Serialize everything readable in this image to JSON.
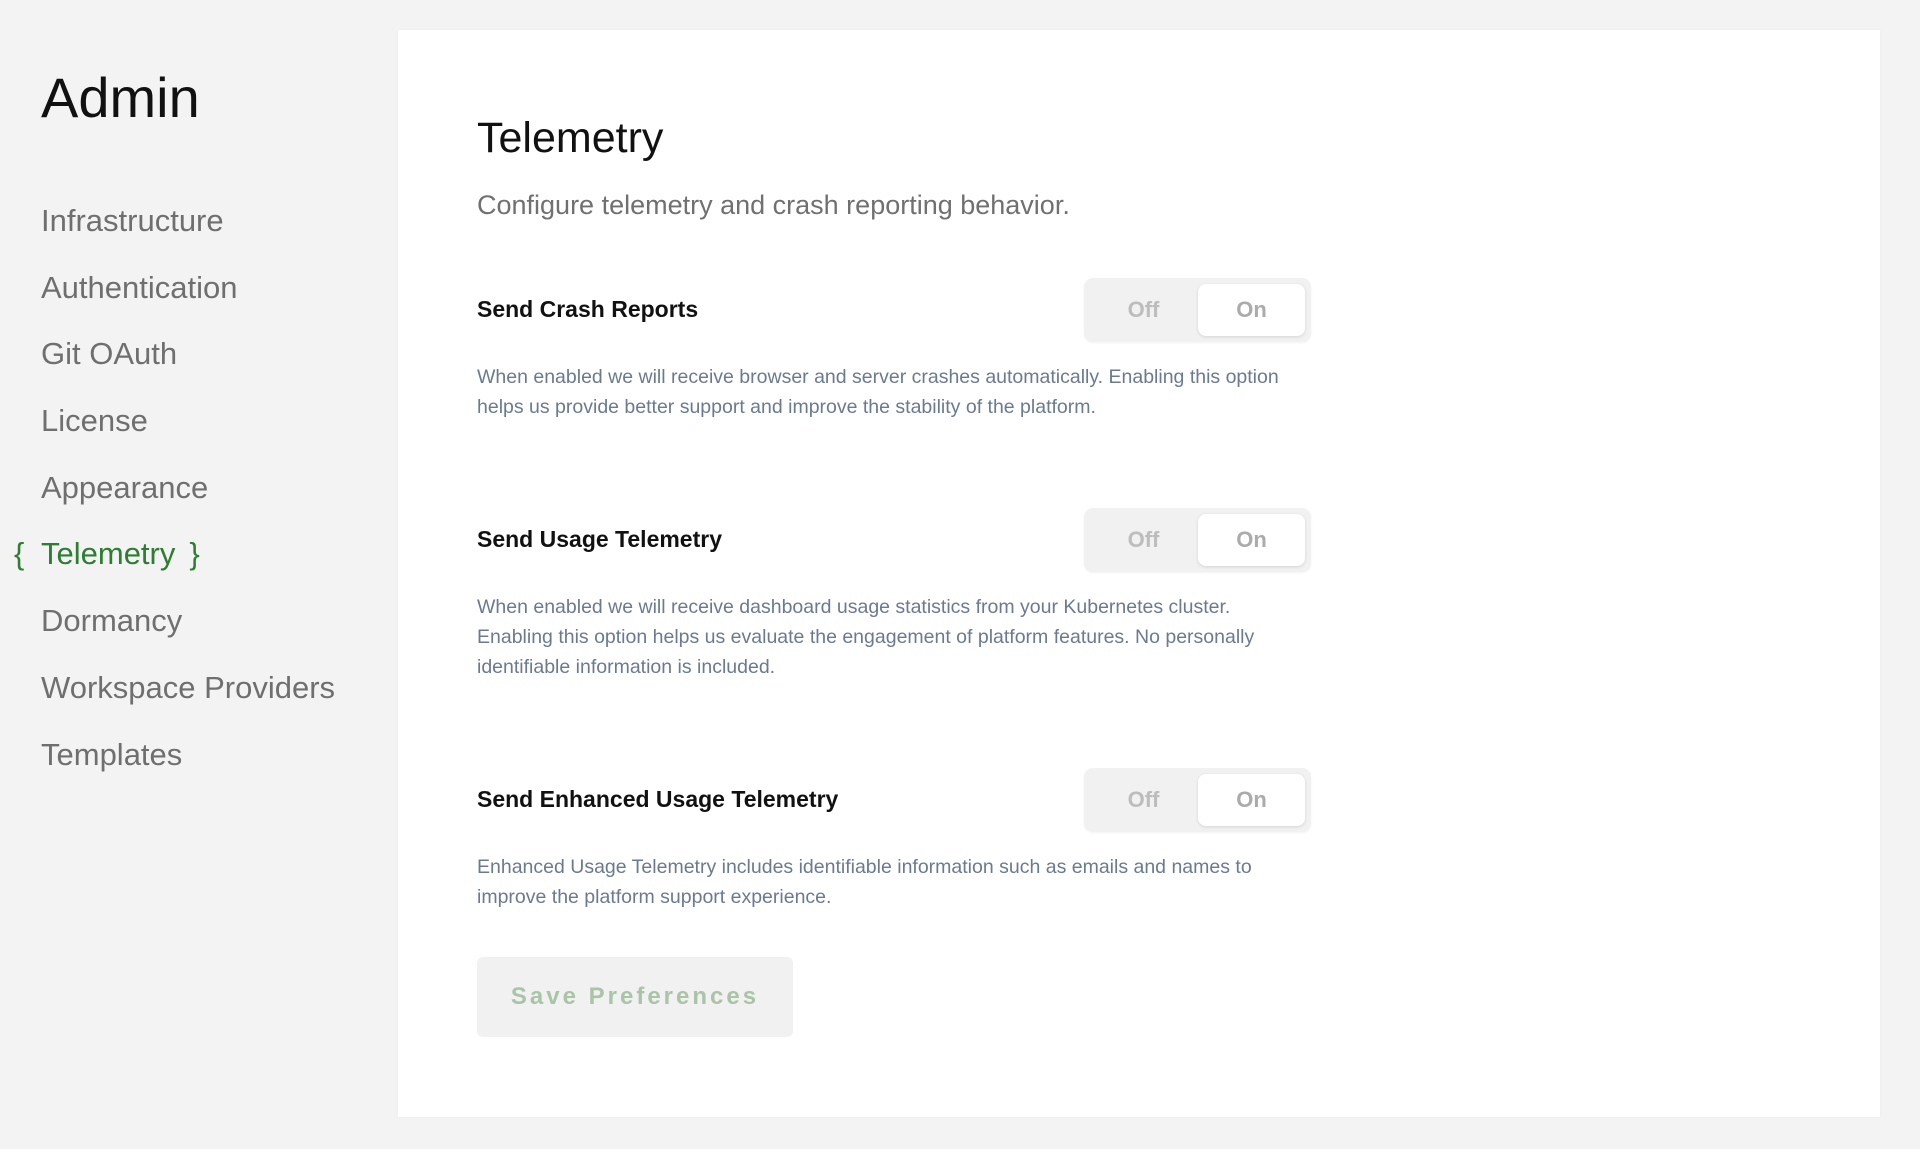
{
  "sidebar": {
    "title": "Admin",
    "items": [
      {
        "label": "Infrastructure"
      },
      {
        "label": "Authentication"
      },
      {
        "label": "Git OAuth"
      },
      {
        "label": "License"
      },
      {
        "label": "Appearance"
      },
      {
        "label": "Telemetry",
        "active": true,
        "brace_open": "{",
        "brace_close": "}"
      },
      {
        "label": "Dormancy"
      },
      {
        "label": "Workspace Providers"
      },
      {
        "label": "Templates"
      }
    ]
  },
  "main": {
    "title": "Telemetry",
    "subtitle": "Configure telemetry and crash reporting behavior.",
    "settings": [
      {
        "label": "Send Crash Reports",
        "off_label": "Off",
        "on_label": "On",
        "value": "On",
        "description": "When enabled we will receive browser and server crashes automatically. Enabling this option helps us provide better support and improve the stability of the platform."
      },
      {
        "label": "Send Usage Telemetry",
        "off_label": "Off",
        "on_label": "On",
        "value": "On",
        "description": "When enabled we will receive dashboard usage statistics from your Kubernetes cluster. Enabling this option helps us evaluate the engagement of platform features. No personally identifiable information is included."
      },
      {
        "label": "Send Enhanced Usage Telemetry",
        "off_label": "Off",
        "on_label": "On",
        "value": "On",
        "description": "Enhanced Usage Telemetry includes identifiable information such as emails and names to improve the platform support experience."
      }
    ],
    "save_label": "Save Preferences"
  },
  "colors": {
    "accent": "#2e7d32",
    "background": "#f3f3f3",
    "card": "#ffffff",
    "description_text": "#6b7a91",
    "save_text_disabled": "#a9c4a6"
  }
}
